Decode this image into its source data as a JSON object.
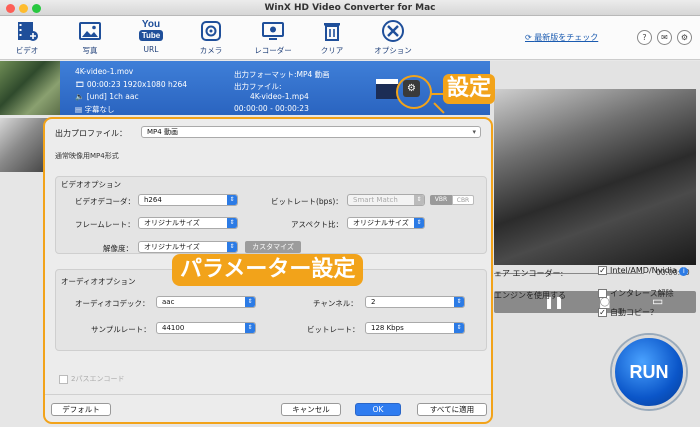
{
  "window": {
    "title": "WinX HD Video Converter for Mac"
  },
  "toolbar": {
    "items": [
      {
        "label": "ビデオ",
        "icon": "film-add-icon"
      },
      {
        "label": "写真",
        "icon": "photo-icon"
      },
      {
        "label": "URL",
        "icon": "youtube-icon",
        "badge_top": "You",
        "badge_bottom": "Tube"
      },
      {
        "label": "カメラ",
        "icon": "camera-icon"
      },
      {
        "label": "レコーダー",
        "icon": "screen-recorder-icon"
      },
      {
        "label": "クリア",
        "icon": "trash-icon"
      },
      {
        "label": "オプション",
        "icon": "tools-icon"
      }
    ],
    "update_link": "最新版をチェック"
  },
  "file": {
    "name": "4K-video-1.mov",
    "duration_info": "00:00:23 1920x1080 h264",
    "audio_info": "[und] 1ch aac",
    "subtitle_info": "字幕なし",
    "output_format_label": "出力フォーマット:MP4 動画",
    "output_file_label": "出力ファイル:",
    "output_file": "4K-video-1.mp4",
    "time_range": "00:00:00 - 00:00:23"
  },
  "preview": {
    "time": "00:00:00"
  },
  "right_options": {
    "encoder_label": "ェア エンコーダー:",
    "intel": "Intel/AMD/Nvidia",
    "engine_label": "エンジンを使用する",
    "deinterlace": "インタレース解除",
    "autocopy": "自動コピー？",
    "run": "RUN"
  },
  "dialog": {
    "profile_label": "出力プロファイル：",
    "profile_value": "MP4 動画",
    "profile_desc": "通常映像用MP4形式",
    "video_section": "ビデオオプション",
    "video_codec_label": "ビデオデコーダ：",
    "video_codec": "h264",
    "bitrate_label": "ビットレート(bps)：",
    "bitrate": "Smart Match",
    "vbr": "VBR",
    "cbr": "CBR",
    "framerate_label": "フレームレート：",
    "framerate": "オリジナルサイズ",
    "aspect_label": "アスペクト比：",
    "aspect": "オリジナルサイズ",
    "resolution_label": "解像度：",
    "resolution": "オリジナルサイズ",
    "customize": "カスタマイズ",
    "audio_section": "オーディオオプション",
    "audio_codec_label": "オーディオコデック：",
    "audio_codec": "aac",
    "channel_label": "チャンネル：",
    "channel": "2",
    "samplerate_label": "サンプルレート：",
    "samplerate": "44100",
    "abitrate_label": "ビットレート：",
    "abitrate": "128 Kbps",
    "passthrough": "2パスエンコード",
    "default_btn": "デフォルト",
    "cancel_btn": "キャンセル",
    "ok_btn": "OK",
    "apply_all_btn": "すべてに適用"
  },
  "callouts": {
    "settings": "設定",
    "params": "パラメーター設定"
  },
  "colors": {
    "accent": "#f2a31a",
    "selection": "#2f6cc9",
    "run": "#0b56c9"
  }
}
